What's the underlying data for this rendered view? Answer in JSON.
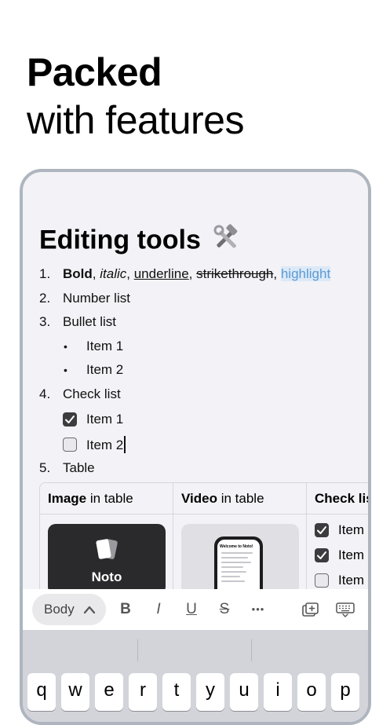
{
  "headline": {
    "bold": "Packed",
    "regular": "with features"
  },
  "editor": {
    "title": "Editing tools",
    "list": {
      "n1": "1.",
      "n2": "2.",
      "n3": "3.",
      "n4": "4.",
      "n5": "5.",
      "fmt_bold": "Bold",
      "fmt_sep1": ", ",
      "fmt_italic": "italic",
      "fmt_sep2": ", ",
      "fmt_underline": "underline",
      "fmt_sep3": ", ",
      "fmt_strike": "strikethrough",
      "fmt_sep4": ", ",
      "fmt_highlight": "highlight",
      "number_list": "Number list",
      "bullet_list": "Bullet list",
      "bullet_item1": "Item 1",
      "bullet_item2": "Item 2",
      "check_list": "Check list",
      "check_item1": "Item 1",
      "check_item2": "Item 2",
      "table": "Table"
    },
    "table": {
      "col1_bold": "Image",
      "col1_rest": " in table",
      "col2_bold": "Video",
      "col2_rest": " in table",
      "col3_bold": "Check list",
      "noto_label": "Noto",
      "video_heading": "Welcome to Noto!",
      "check_items": [
        "Item",
        "Item",
        "Item"
      ]
    }
  },
  "toolbar": {
    "style_label": "Body",
    "bold": "B",
    "italic": "I",
    "underline": "U",
    "strike": "S",
    "more": "•••"
  },
  "keyboard": {
    "keys": [
      "q",
      "w",
      "e",
      "r",
      "t",
      "y",
      "u",
      "i",
      "o",
      "p"
    ]
  },
  "colors": {
    "highlight_text": "#5b9bd5",
    "highlight_bg": "#dce9f7",
    "frame": "#aeb5be"
  }
}
